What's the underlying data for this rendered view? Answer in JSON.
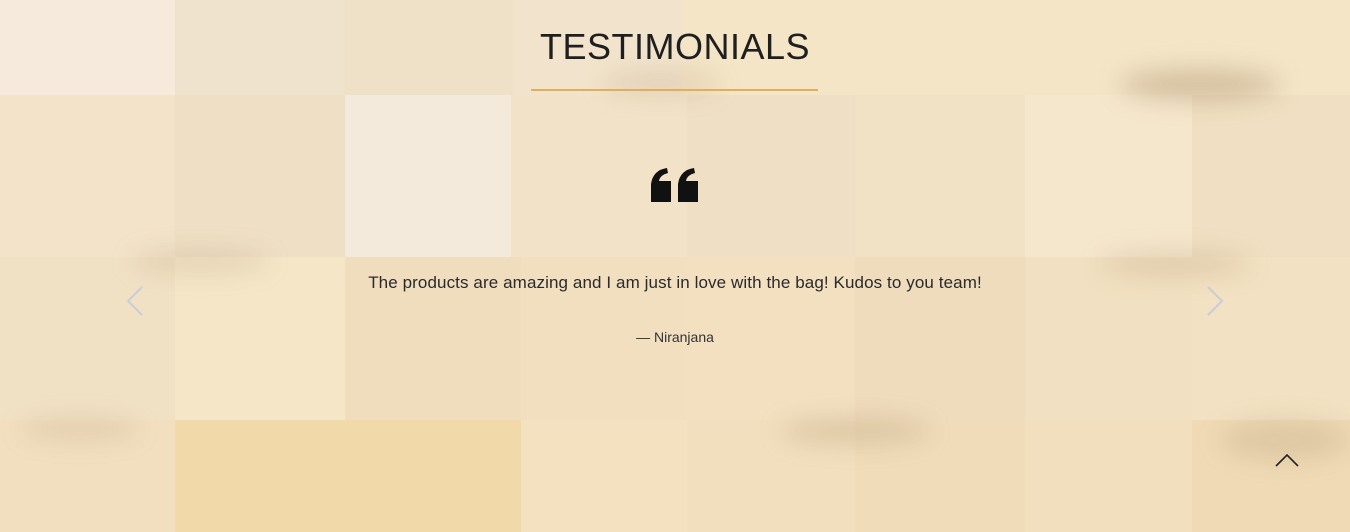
{
  "section": {
    "title": "TESTIMONIALS",
    "accent_color": "#e3ad5e"
  },
  "testimonial": {
    "quote": "The products are amazing and I am just in love with the bag! Kudos to you team!",
    "author": "— Niranjana"
  },
  "icons": {
    "quote": "quote-mark-icon",
    "prev": "chevron-left-icon",
    "next": "chevron-right-icon",
    "back_to_top": "chevron-up-icon"
  }
}
